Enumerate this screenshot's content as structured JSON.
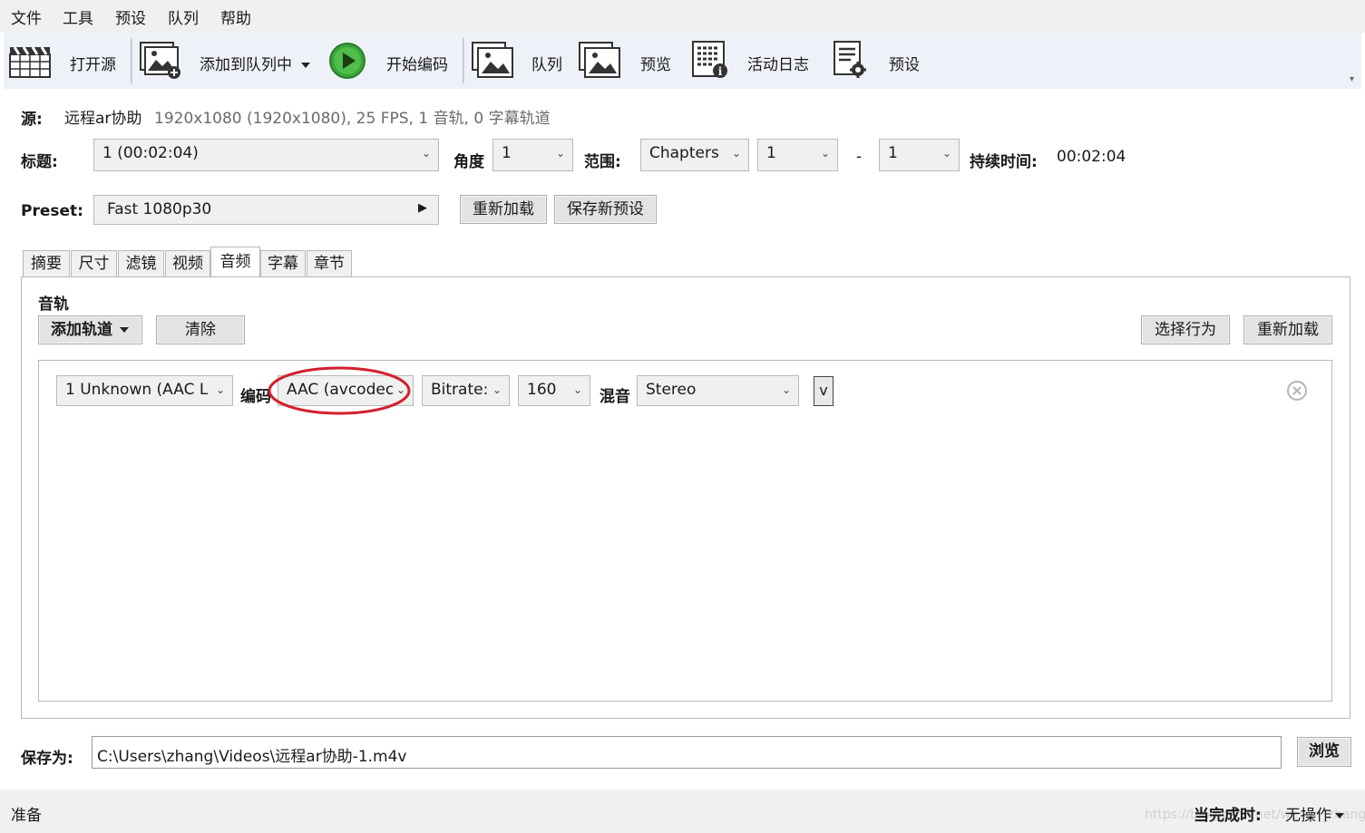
{
  "menu": [
    "文件",
    "工具",
    "预设",
    "队列",
    "帮助"
  ],
  "toolbar": {
    "open_source": "打开源",
    "add_to_queue": "添加到队列中",
    "start_encode": "开始编码",
    "queue": "队列",
    "preview": "预览",
    "activity_log": "活动日志",
    "presets": "预设"
  },
  "source": {
    "label": "源:",
    "name": "远程ar协助",
    "info": "1920x1080 (1920x1080), 25 FPS, 1 音轨, 0 字幕轨道"
  },
  "title_row": {
    "title_label": "标题:",
    "title_value": "1  (00:02:04)",
    "angle_label": "角度",
    "angle_value": "1",
    "range_label": "范围:",
    "range_mode": "Chapters",
    "range_start": "1",
    "range_dash": "-",
    "range_end": "1",
    "duration_label": "持续时间:",
    "duration_value": "00:02:04"
  },
  "preset_row": {
    "label": "Preset:",
    "value": "Fast 1080p30",
    "reload": "重新加载",
    "save_new": "保存新预设"
  },
  "tabs": [
    "摘要",
    "尺寸",
    "滤镜",
    "视频",
    "音频",
    "字幕",
    "章节"
  ],
  "active_tab": "音频",
  "audio": {
    "section_label": "音轨",
    "add_track": "添加轨道",
    "clear": "清除",
    "select_behavior": "选择行为",
    "reload": "重新加载",
    "track": {
      "source": "1 Unknown (AAC L",
      "codec_label": "编码",
      "codec": "AAC (avcodec",
      "bitrate_mode": "Bitrate:",
      "bitrate": "160",
      "mixdown_label": "混音",
      "mixdown": "Stereo",
      "expand": "v"
    }
  },
  "save": {
    "label": "保存为:",
    "path": "C:\\Users\\zhang\\Videos\\远程ar协助-1.m4v",
    "browse": "浏览"
  },
  "status": {
    "text": "准备",
    "when_done_label": "当完成时:",
    "when_done_value": "无操作",
    "watermark": "https://blog.csdn.net/weixin_zhang"
  },
  "colors": {
    "annotation_circle": "#d21f2b",
    "toolbar_bg": "#eef2f8",
    "play_green": "#3aa33a"
  }
}
